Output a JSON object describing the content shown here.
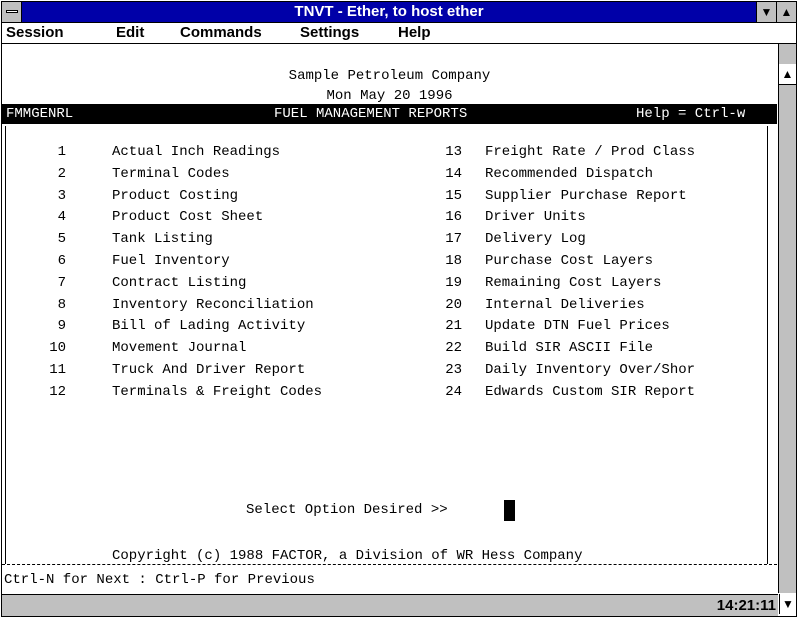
{
  "window": {
    "title": "TNVT - Ether, to host ether",
    "min_icon": "▼",
    "max_icon": "▲"
  },
  "menu": {
    "items": [
      "Session",
      "Edit",
      "Commands",
      "Settings",
      "Help"
    ]
  },
  "terminal": {
    "company": "Sample Petroleum Company",
    "date": "Mon May 20 1996",
    "program_id": "FMMGENRL",
    "screen_title": "FUEL MANAGEMENT REPORTS",
    "help_hint": "Help = Ctrl-w",
    "options": [
      {
        "num": "1",
        "label": "Actual Inch Readings"
      },
      {
        "num": "2",
        "label": "Terminal Codes"
      },
      {
        "num": "3",
        "label": "Product Costing"
      },
      {
        "num": "4",
        "label": "Product Cost Sheet"
      },
      {
        "num": "5",
        "label": "Tank Listing"
      },
      {
        "num": "6",
        "label": "Fuel Inventory"
      },
      {
        "num": "7",
        "label": "Contract Listing"
      },
      {
        "num": "8",
        "label": "Inventory Reconciliation"
      },
      {
        "num": "9",
        "label": "Bill of Lading Activity"
      },
      {
        "num": "10",
        "label": "Movement Journal"
      },
      {
        "num": "11",
        "label": "Truck And Driver Report"
      },
      {
        "num": "12",
        "label": "Terminals & Freight Codes"
      },
      {
        "num": "13",
        "label": "Freight Rate / Prod Class"
      },
      {
        "num": "14",
        "label": "Recommended Dispatch"
      },
      {
        "num": "15",
        "label": "Supplier Purchase Report"
      },
      {
        "num": "16",
        "label": "Driver Units"
      },
      {
        "num": "17",
        "label": "Delivery Log"
      },
      {
        "num": "18",
        "label": "Purchase Cost Layers"
      },
      {
        "num": "19",
        "label": "Remaining Cost Layers"
      },
      {
        "num": "20",
        "label": "Internal Deliveries"
      },
      {
        "num": "21",
        "label": "Update DTN Fuel Prices"
      },
      {
        "num": "22",
        "label": "Build SIR ASCII File"
      },
      {
        "num": "23",
        "label": "Daily Inventory Over/Shor"
      },
      {
        "num": "24",
        "label": "Edwards Custom SIR Report"
      }
    ],
    "prompt": "Select Option Desired >>",
    "copyright": "Copyright (c) 1988 FACTOR, a Division of WR Hess Company",
    "footer": "Ctrl-N for Next : Ctrl-P for Previous"
  },
  "scrollbar": {
    "up_icon": "▲",
    "down_icon": "▼"
  },
  "status": {
    "clock": "14:21:11"
  }
}
